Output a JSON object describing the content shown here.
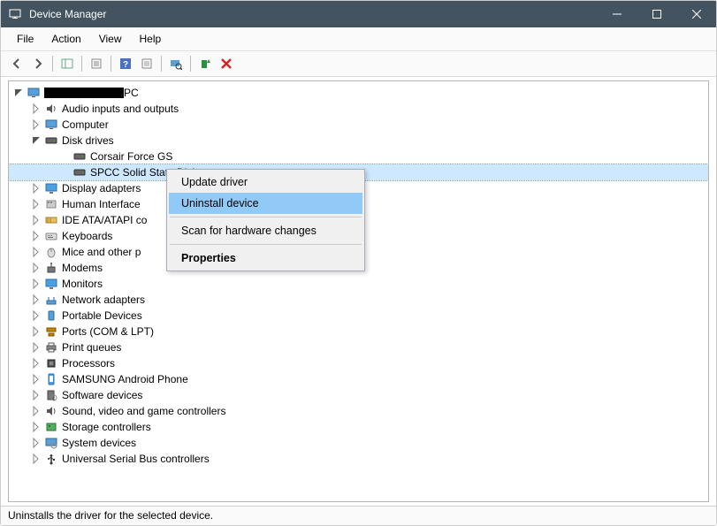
{
  "window": {
    "title": "Device Manager"
  },
  "menu": {
    "items": [
      "File",
      "Action",
      "View",
      "Help"
    ]
  },
  "toolbar": {
    "buttons": [
      {
        "name": "back-icon"
      },
      {
        "name": "forward-icon"
      },
      {
        "name": "show-hide-console-tree-icon"
      },
      {
        "name": "properties-icon"
      },
      {
        "name": "help-icon"
      },
      {
        "name": "options-icon"
      },
      {
        "name": "scan-hardware-icon"
      },
      {
        "name": "enable-device-icon"
      },
      {
        "name": "uninstall-device-icon"
      }
    ]
  },
  "tree": {
    "root": {
      "label_suffix": "PC",
      "children": [
        {
          "label": "Audio inputs and outputs",
          "icon": "audio-icon",
          "expandable": true,
          "expanded": false
        },
        {
          "label": "Computer",
          "icon": "computer-icon",
          "expandable": true,
          "expanded": false
        },
        {
          "label": "Disk drives",
          "icon": "disk-icon",
          "expandable": true,
          "expanded": true,
          "children": [
            {
              "label": "Corsair Force GS",
              "icon": "disk-icon",
              "expandable": false
            },
            {
              "label": "SPCC Solid State Disk",
              "icon": "disk-icon",
              "expandable": false,
              "selected": true
            }
          ]
        },
        {
          "label": "Display adapters",
          "icon": "display-icon",
          "expandable": true,
          "expanded": false
        },
        {
          "label": "Human Interface",
          "icon": "hid-icon",
          "expandable": true,
          "expanded": false,
          "truncated": true
        },
        {
          "label": "IDE ATA/ATAPI co",
          "icon": "ide-icon",
          "expandable": true,
          "expanded": false,
          "truncated": true
        },
        {
          "label": "Keyboards",
          "icon": "keyboard-icon",
          "expandable": true,
          "expanded": false
        },
        {
          "label": "Mice and other p",
          "icon": "mouse-icon",
          "expandable": true,
          "expanded": false,
          "truncated": true
        },
        {
          "label": "Modems",
          "icon": "modem-icon",
          "expandable": true,
          "expanded": false
        },
        {
          "label": "Monitors",
          "icon": "monitor-icon",
          "expandable": true,
          "expanded": false
        },
        {
          "label": "Network adapters",
          "icon": "network-icon",
          "expandable": true,
          "expanded": false
        },
        {
          "label": "Portable Devices",
          "icon": "portable-icon",
          "expandable": true,
          "expanded": false
        },
        {
          "label": "Ports (COM & LPT)",
          "icon": "ports-icon",
          "expandable": true,
          "expanded": false
        },
        {
          "label": "Print queues",
          "icon": "printer-icon",
          "expandable": true,
          "expanded": false
        },
        {
          "label": "Processors",
          "icon": "processor-icon",
          "expandable": true,
          "expanded": false
        },
        {
          "label": "SAMSUNG Android Phone",
          "icon": "phone-icon",
          "expandable": true,
          "expanded": false
        },
        {
          "label": "Software devices",
          "icon": "software-icon",
          "expandable": true,
          "expanded": false
        },
        {
          "label": "Sound, video and game controllers",
          "icon": "sound-icon",
          "expandable": true,
          "expanded": false
        },
        {
          "label": "Storage controllers",
          "icon": "storage-icon",
          "expandable": true,
          "expanded": false
        },
        {
          "label": "System devices",
          "icon": "system-icon",
          "expandable": true,
          "expanded": false
        },
        {
          "label": "Universal Serial Bus controllers",
          "icon": "usb-icon",
          "expandable": true,
          "expanded": false
        }
      ]
    }
  },
  "context_menu": {
    "items": [
      {
        "label": "Update driver",
        "highlighted": false
      },
      {
        "label": "Uninstall device",
        "highlighted": true
      },
      {
        "sep": true
      },
      {
        "label": "Scan for hardware changes",
        "highlighted": false
      },
      {
        "sep": true
      },
      {
        "label": "Properties",
        "highlighted": false,
        "bold": true
      }
    ]
  },
  "status": {
    "text": "Uninstalls the driver for the selected device."
  }
}
